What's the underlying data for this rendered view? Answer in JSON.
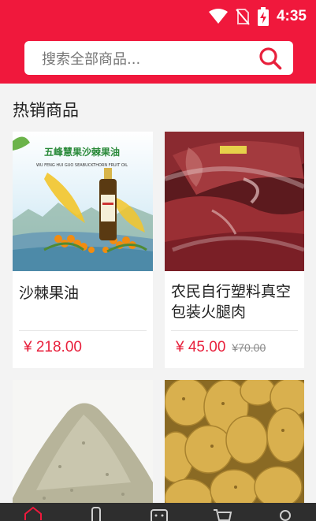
{
  "status": {
    "time": "4:35",
    "icons": [
      "wifi-icon",
      "no-sim-icon",
      "battery-charging-icon"
    ]
  },
  "search": {
    "placeholder": "搜索全部商品..."
  },
  "section": {
    "title": "热销商品"
  },
  "products": [
    {
      "name": "沙棘果油",
      "price": "¥ 218.00",
      "old_price": "",
      "image_text": [
        "五峰慧果沙棘果油",
        "WU FENG HUI GUO SEABUCKTHORN FRUIT OIL"
      ]
    },
    {
      "name": "农民自行塑料真空包装火腿肉",
      "price": "¥ 45.00",
      "old_price": "¥70.00"
    },
    {
      "name": "",
      "price": "",
      "old_price": ""
    },
    {
      "name": "",
      "price": "",
      "old_price": ""
    }
  ],
  "tabbar": {
    "icons": [
      "home-icon",
      "category-icon",
      "message-icon",
      "cart-icon",
      "user-icon"
    ]
  },
  "colors": {
    "brand": "#f0183c",
    "price": "#e8203c",
    "tabbar": "#2e2e2e"
  }
}
